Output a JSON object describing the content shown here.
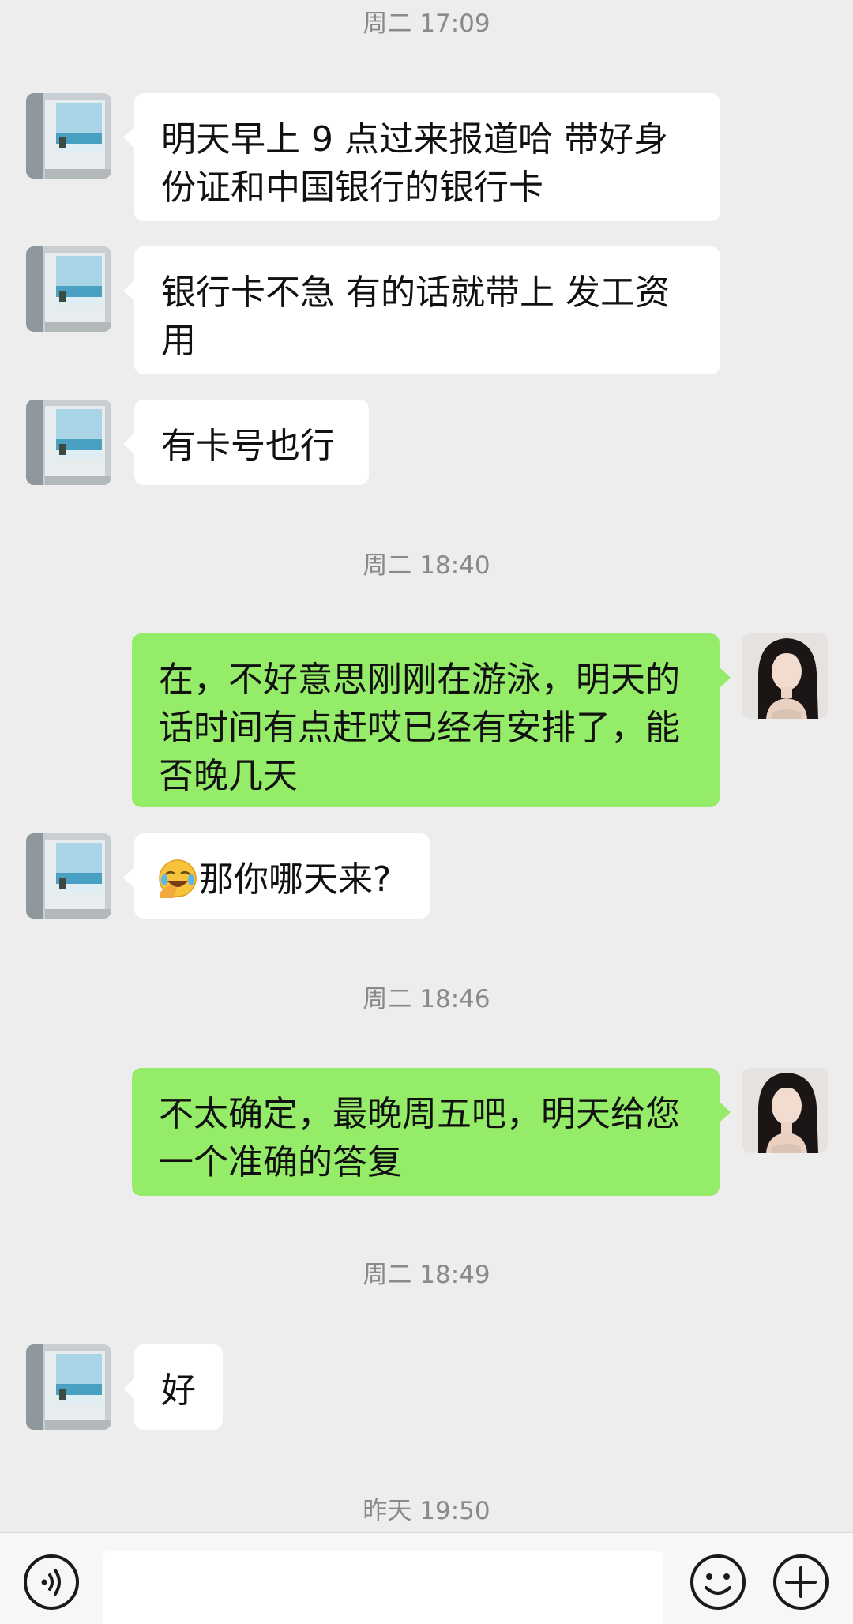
{
  "timestamps": {
    "t1": "周二 17:09",
    "t2": "周二 18:40",
    "t3": "周二 18:46",
    "t4": "周二 18:49",
    "t5": "昨天 19:50"
  },
  "messages": {
    "m1": "明天早上 9 点过来报道哈 带好身份证和中国银行的银行卡",
    "m2": "银行卡不急 有的话就带上 发工资用",
    "m3": "有卡号也行",
    "m4": "在，不好意思刚刚在游泳，明天的话时间有点赶哎已经有安排了，能否晚几天",
    "m5": "那你哪天来?",
    "m6": "不太确定，最晚周五吧，明天给您一个准确的答复",
    "m7": "好"
  },
  "input": {
    "value": ""
  },
  "icons": {
    "voice": "voice-icon",
    "emoji": "emoji-icon",
    "plus": "plus-icon",
    "facepalm": "facepalm-laugh-emoji"
  },
  "colors": {
    "background": "#ededed",
    "incoming_bubble": "#ffffff",
    "outgoing_bubble": "#95ec69",
    "timestamp_text": "#8a8a8a"
  }
}
